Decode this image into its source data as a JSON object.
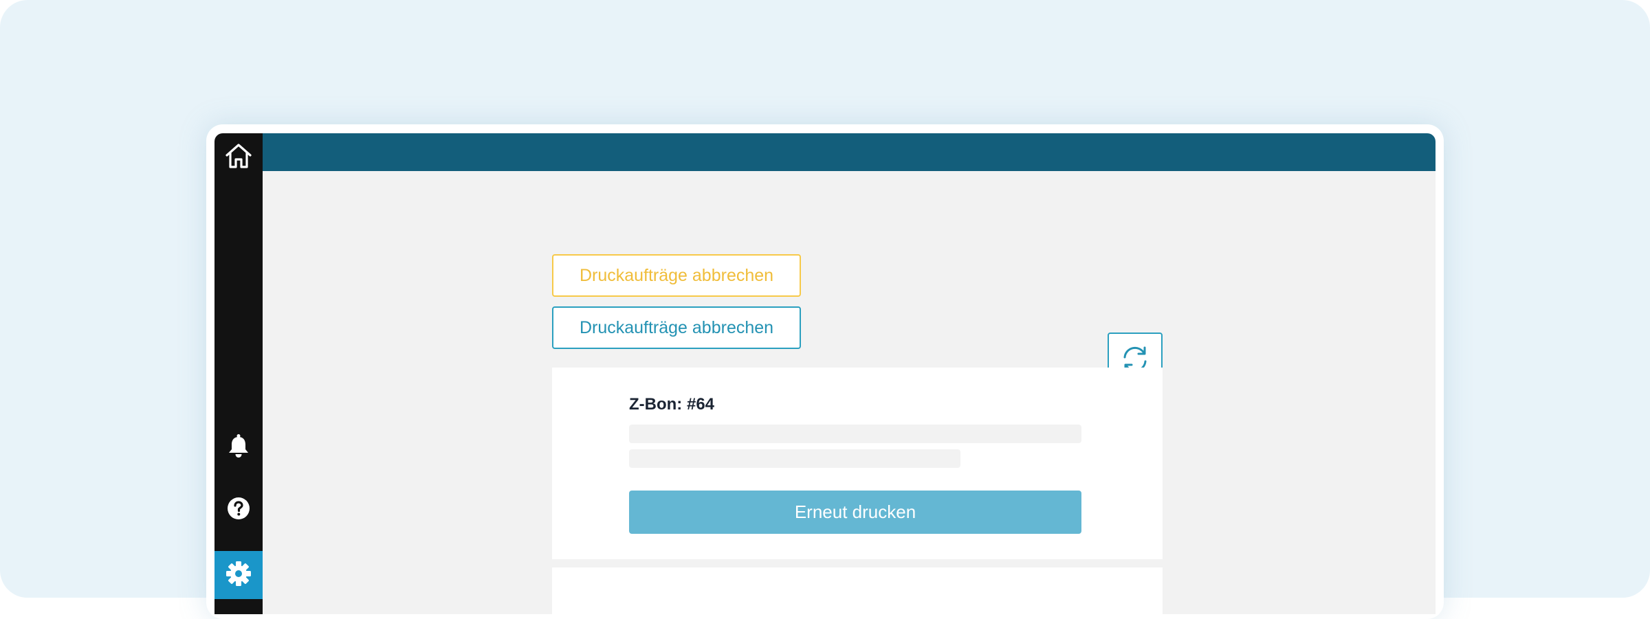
{
  "colors": {
    "backdrop": "#e8f3f9",
    "sidebar": "#121212",
    "topbar": "#135e7b",
    "content": "#f2f2f2",
    "accent": "#1a96c9",
    "warning": "#f7c948",
    "primary_outline": "#2a9fbf",
    "print_button": "#64b7d3"
  },
  "sidebar": {
    "items": [
      {
        "icon": "home-icon"
      },
      {
        "icon": "bell-icon"
      },
      {
        "icon": "help-icon"
      },
      {
        "icon": "gear-icon",
        "active": true
      }
    ]
  },
  "toolbar": {
    "cancel_jobs_warning_label": "Druckaufträge abbrechen",
    "cancel_jobs_label": "Druckaufträge abbrechen",
    "refresh_icon": "refresh-icon"
  },
  "zbon_card": {
    "title": "Z-Bon: #64",
    "reprint_label": "Erneut drucken"
  }
}
